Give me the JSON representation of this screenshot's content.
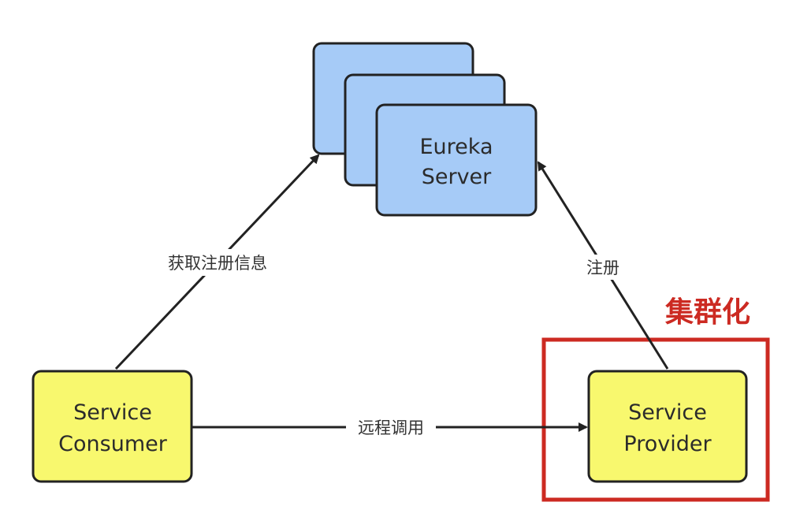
{
  "nodes": {
    "eureka_server": {
      "line1": "Eureka",
      "line2": "Server"
    },
    "consumer": {
      "line1": "Service",
      "line2": "Consumer"
    },
    "provider": {
      "line1": "Service",
      "line2": "Provider"
    }
  },
  "edges": {
    "fetch_registry": "获取注册信息",
    "register": "注册",
    "remote_call": "远程调用"
  },
  "cluster_label": "集群化",
  "colors": {
    "server_fill": "#a6cbf7",
    "service_fill": "#f8f86e",
    "stroke": "#222222",
    "highlight": "#cc2a22"
  }
}
